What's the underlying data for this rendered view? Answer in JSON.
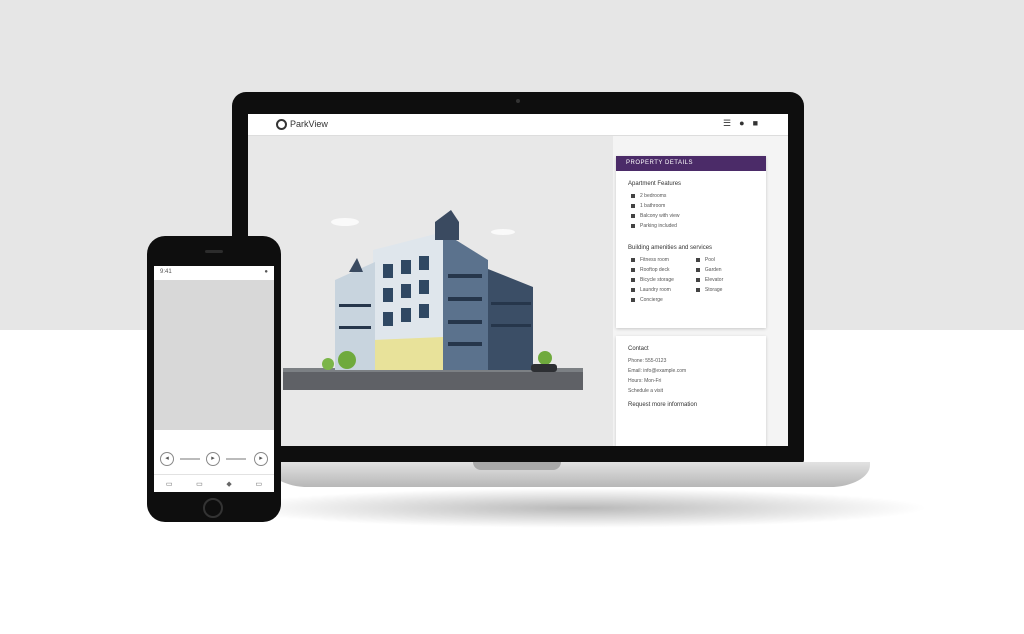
{
  "desktop": {
    "brand": "ParkView",
    "nav_icons": [
      "menu-icon",
      "user-icon",
      "cart-icon"
    ],
    "sidebar": {
      "header": "PROPERTY DETAILS",
      "overview_title": "Apartment Features",
      "overview_items": [
        "2 bedrooms",
        "1 bathroom",
        "Balcony with view",
        "Parking included"
      ],
      "amenities_title": "Building amenities and services",
      "amenities_col1": [
        "Fitness room",
        "Rooftop deck",
        "Bicycle storage",
        "Laundry room",
        "Concierge"
      ],
      "amenities_col2": [
        "Pool",
        "Garden",
        "Elevator",
        "Storage"
      ],
      "contact_title": "Contact",
      "contact_lines": [
        "Phone: 555-0123",
        "Email: info@example.com",
        "Hours: Mon-Fri",
        "Schedule a visit"
      ],
      "contact_footer": "Request more information"
    }
  },
  "mobile": {
    "status_left": "9:41",
    "status_right": "●",
    "tab_icons": [
      "home-icon",
      "search-icon",
      "heart-icon",
      "profile-icon"
    ]
  },
  "colors": {
    "accent": "#4b2b68",
    "background": "#e6e6e6"
  }
}
